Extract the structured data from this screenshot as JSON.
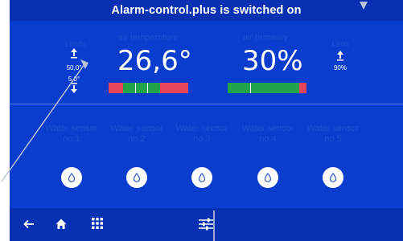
{
  "header": {
    "title": "Alarm-control.plus is switched on"
  },
  "climate": {
    "limits_label": "Limits",
    "upper_limit_temp": "50,0°",
    "lower_limit_temp": "5,0°",
    "air_temperature_label": "air temperature",
    "air_temperature_value": "26,6°",
    "air_humidity_label": "air humidity",
    "air_humidity_value": "30%",
    "limit_label": "Limit",
    "upper_limit_humidity": "90%"
  },
  "sensors": [
    {
      "line1": "Water sensor",
      "line2": "no.1"
    },
    {
      "line1": "Water sensor",
      "line2": "no.2"
    },
    {
      "line1": "Water sensor",
      "line2": "no.3"
    },
    {
      "line1": "Water sensor",
      "line2": "no.4"
    },
    {
      "line1": "Water sensor",
      "line2": "no.5"
    }
  ],
  "icons": {
    "nav": [
      "back-arrow-icon",
      "home-icon",
      "grid-menu-icon",
      "sliders-icon"
    ],
    "sensor_button": "water-drop-icon",
    "limit_up": "arrow-up-icon",
    "limit_down": "arrow-down-icon"
  },
  "colors": {
    "background": "#0a3ccd",
    "bar_red": "#e8455a",
    "bar_green": "#22a34a",
    "text": "#ffffff",
    "label_dim": "#1b50d4"
  }
}
